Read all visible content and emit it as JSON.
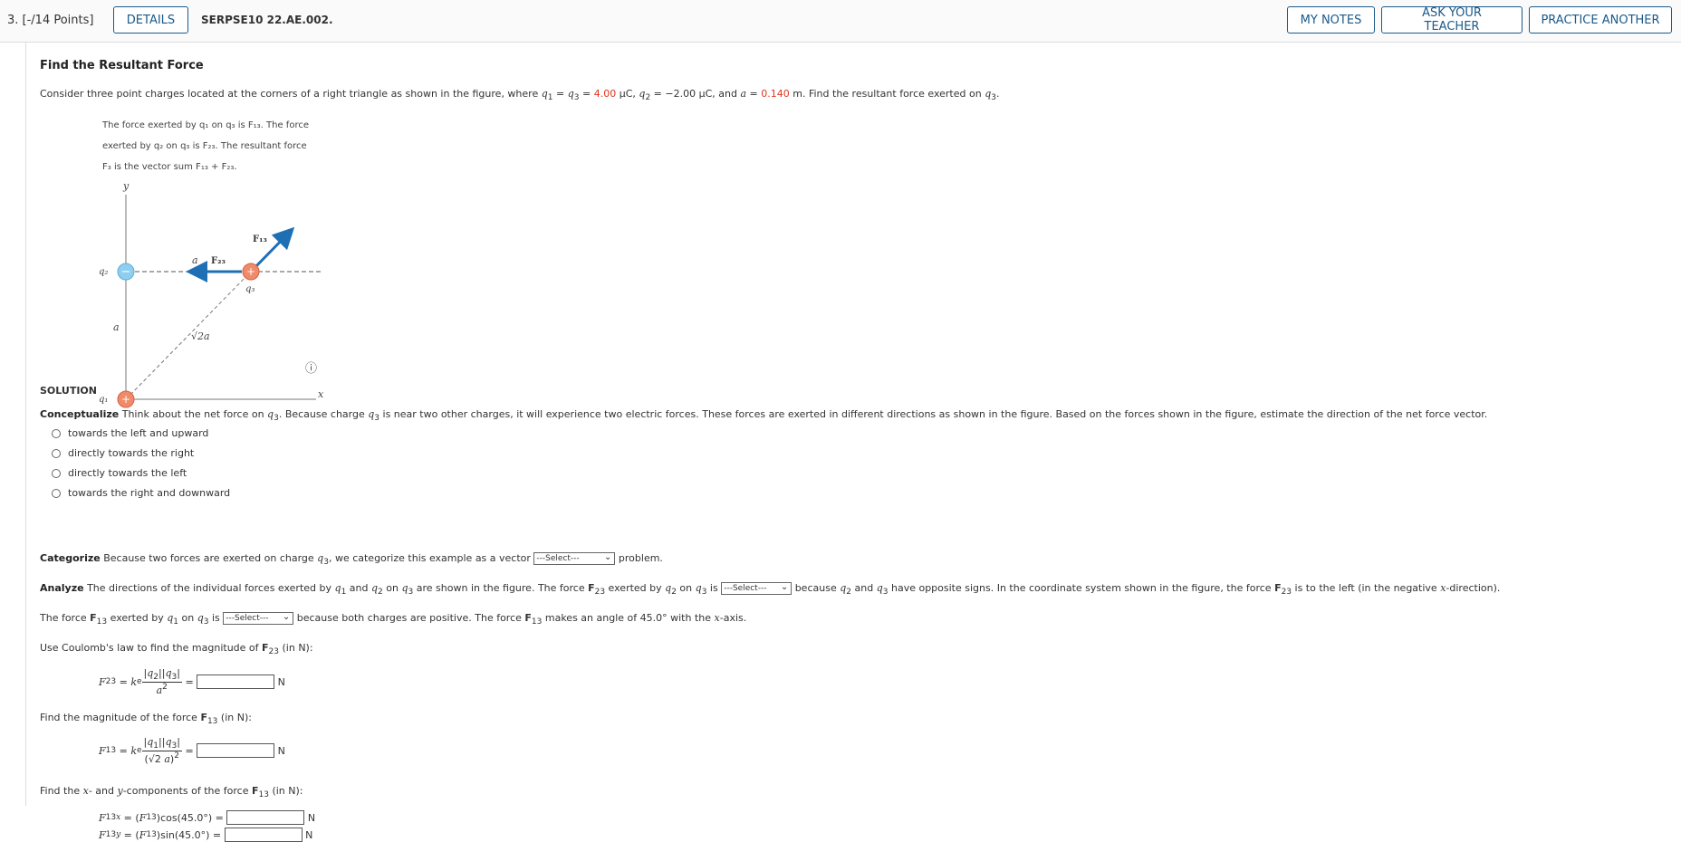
{
  "header": {
    "points": "3. [-/14 Points]",
    "details_label": "DETAILS",
    "code": "SERPSE10 22.AE.002.",
    "my_notes": "MY NOTES",
    "ask_teacher": "ASK YOUR TEACHER",
    "practice_another": "PRACTICE ANOTHER"
  },
  "problem": {
    "title": "Find the Resultant Force",
    "q1q3_val": "4.00",
    "q2_val": "−2.00",
    "a_val": "0.140",
    "caption_line1": "The force exerted by q₁ on q₃ is F₁₃. The force",
    "caption_line2": "exerted by q₂ on q₃ is F₂₃. The resultant force",
    "caption_line3": "F₃ is the vector sum F₁₃ + F₂₃.",
    "fig_y": "y",
    "fig_x": "x",
    "fig_a_top": "a",
    "fig_a_left": "a",
    "fig_f13": "F₁₃",
    "fig_f23": "F₂₃",
    "fig_q1": "q₁",
    "fig_q2": "q₂",
    "fig_q3": "q₃",
    "fig_diag": "√2a",
    "fig_minus": "−",
    "fig_plus": "+",
    "info_icon": "ⓘ"
  },
  "solution": {
    "heading": "SOLUTION",
    "conceptualize_label": "Conceptualize",
    "options": [
      "towards the left and upward",
      "directly towards the right",
      "directly towards the left",
      "towards the right and downward"
    ],
    "categorize_label": "Categorize",
    "select_label": "---Select---",
    "analyze_label": "Analyze",
    "angle": "45.0°",
    "unit_n": "N"
  },
  "colors": {
    "accent": "#1a5a8a",
    "red": "#e0331e",
    "charge_pos": "#f08a6a",
    "charge_neg": "#8ecff0",
    "arrow": "#1f6fb5"
  }
}
